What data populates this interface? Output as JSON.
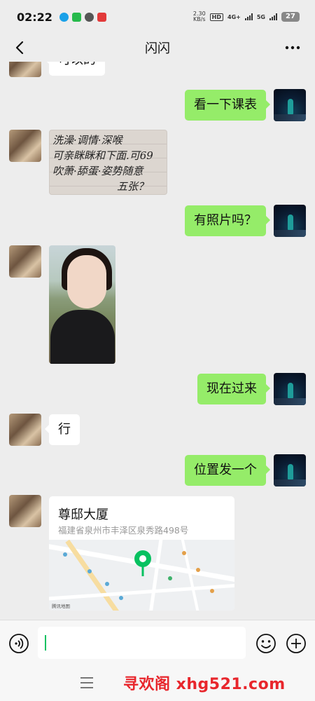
{
  "status_bar": {
    "time": "02:22",
    "net_speed_value": "2.30",
    "net_speed_unit": "KB/s",
    "hd_tag": "HD",
    "network_1": "4G+",
    "network_2": "5G",
    "battery": "27"
  },
  "header": {
    "title": "闪闪"
  },
  "messages": [
    {
      "id": "m0",
      "sender": "her",
      "type": "text",
      "text": "可以的"
    },
    {
      "id": "m1",
      "sender": "me",
      "type": "text",
      "text": "看一下课表"
    },
    {
      "id": "m2",
      "sender": "her",
      "type": "image",
      "kind": "handwritten_note",
      "lines": [
        "洗澡·调情·深喉",
        "可亲眯眯和下面.可69",
        "吹萧·舔蛋·姿势随意",
        "五张？"
      ]
    },
    {
      "id": "m3",
      "sender": "me",
      "type": "text",
      "text": "有照片吗？"
    },
    {
      "id": "m4",
      "sender": "her",
      "type": "image",
      "kind": "photo"
    },
    {
      "id": "m5",
      "sender": "me",
      "type": "text",
      "text": "现在过来"
    },
    {
      "id": "m6",
      "sender": "her",
      "type": "text",
      "text": "行"
    },
    {
      "id": "m7",
      "sender": "me",
      "type": "text",
      "text": "位置发一个"
    },
    {
      "id": "m8",
      "sender": "her",
      "type": "location",
      "name": "尊邸大厦",
      "address": "福建省泉州市丰泽区泉秀路498号",
      "map_brand": "腾讯地图"
    }
  ],
  "input_bar": {
    "value": "",
    "placeholder": ""
  },
  "watermark": "寻欢阁 xhg521.com",
  "colors": {
    "background": "#ededed",
    "outgoing_bubble": "#95ec69",
    "incoming_bubble": "#ffffff",
    "accent": "#07c160",
    "watermark": "#e8262c"
  },
  "icons": {
    "back": "back-icon",
    "more": "more-icon",
    "voice": "voice-icon",
    "emoji": "emoji-icon",
    "plus": "plus-icon",
    "menu": "menu-icon",
    "pin": "location-pin-icon"
  }
}
